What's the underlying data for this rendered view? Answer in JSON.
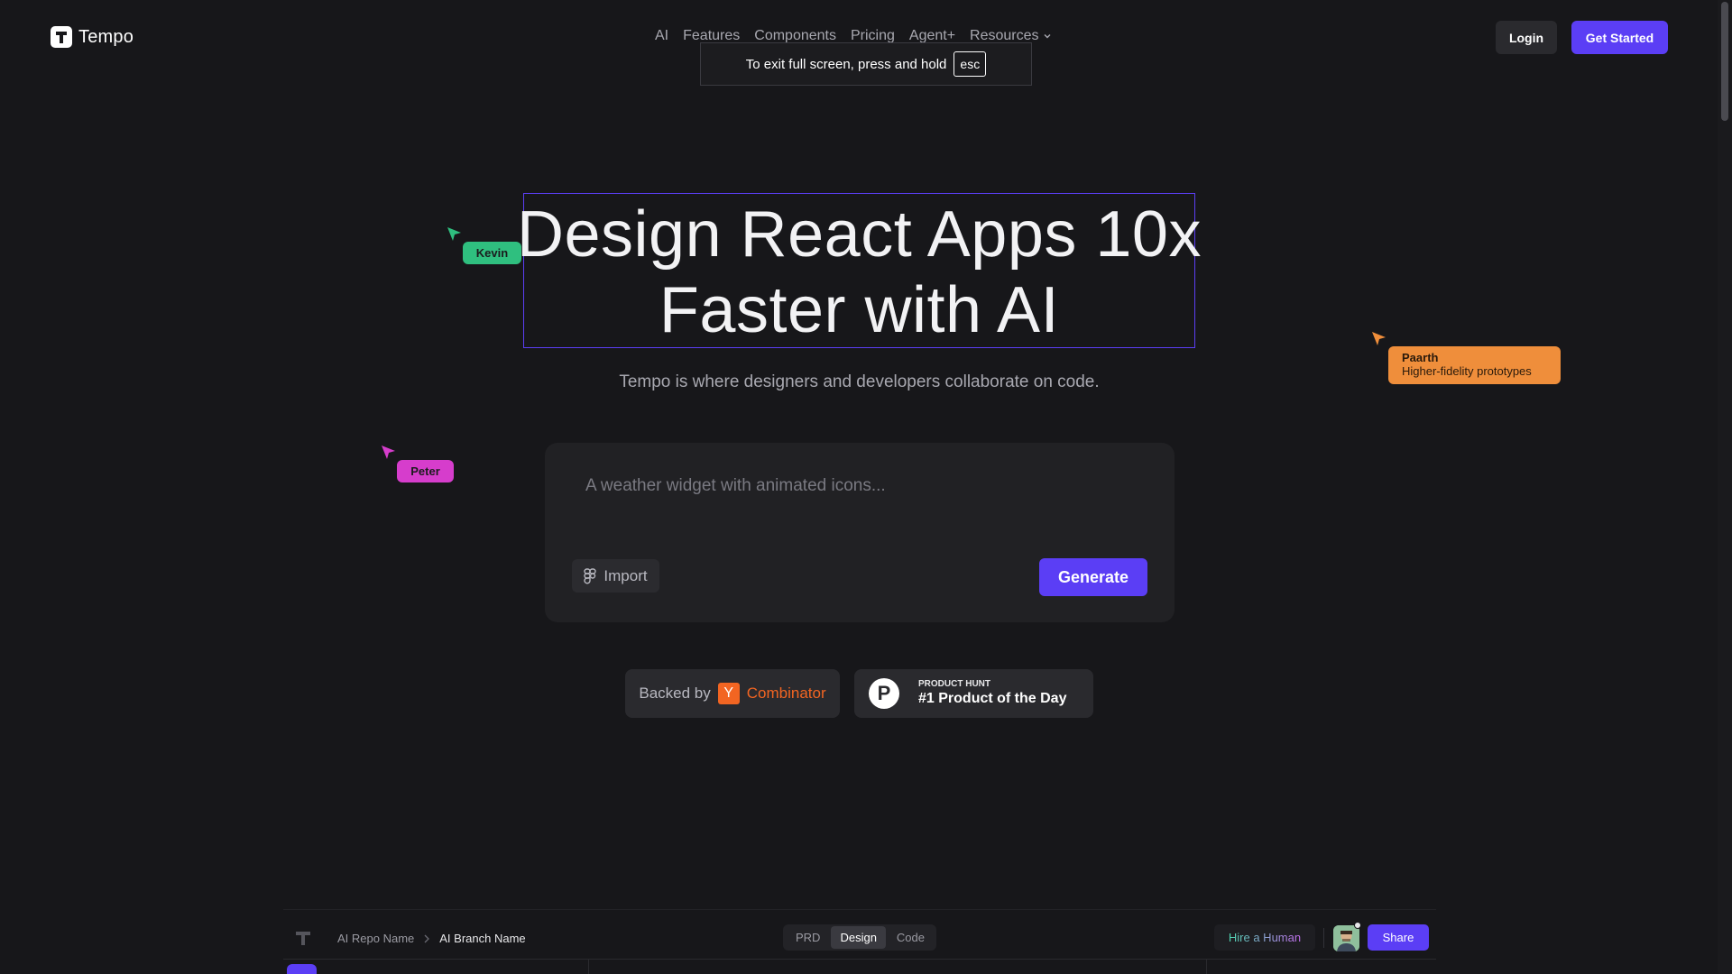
{
  "brand": {
    "name": "Tempo"
  },
  "nav": {
    "items": [
      "AI",
      "Features",
      "Components",
      "Pricing",
      "Agent+",
      "Resources"
    ],
    "login": "Login",
    "get_started": "Get Started"
  },
  "fullscreen_toast": {
    "text": "To exit full screen, press and hold",
    "key": "esc"
  },
  "hero": {
    "title_line1": "Design React Apps 10x",
    "title_line2": "Faster with AI",
    "subtitle": "Tempo is where designers and developers collaborate on code."
  },
  "cursors": {
    "kevin": {
      "name": "Kevin",
      "color": "#2fbf7f"
    },
    "peter": {
      "name": "Peter",
      "color": "#d63dcc"
    },
    "paarth": {
      "name": "Paarth",
      "note": "Higher-fidelity prototypes",
      "color": "#ef8e3b"
    }
  },
  "prompt": {
    "placeholder": "A weather widget with animated icons...",
    "import_label": "Import",
    "generate_label": "Generate"
  },
  "badges": {
    "backed_by": "Backed by",
    "yc_letter": "Y",
    "yc_name": "Combinator",
    "ph_letter": "P",
    "ph_label": "PRODUCT HUNT",
    "ph_title": "#1 Product of the Day"
  },
  "preview": {
    "repo": "AI Repo Name",
    "branch": "AI Branch Name",
    "tabs": [
      "PRD",
      "Design",
      "Code"
    ],
    "active_tab": "Design",
    "hire": "Hire a Human",
    "share": "Share"
  },
  "colors": {
    "accent": "#5b3ef5",
    "background": "#17171a",
    "yc_orange": "#f26522"
  }
}
